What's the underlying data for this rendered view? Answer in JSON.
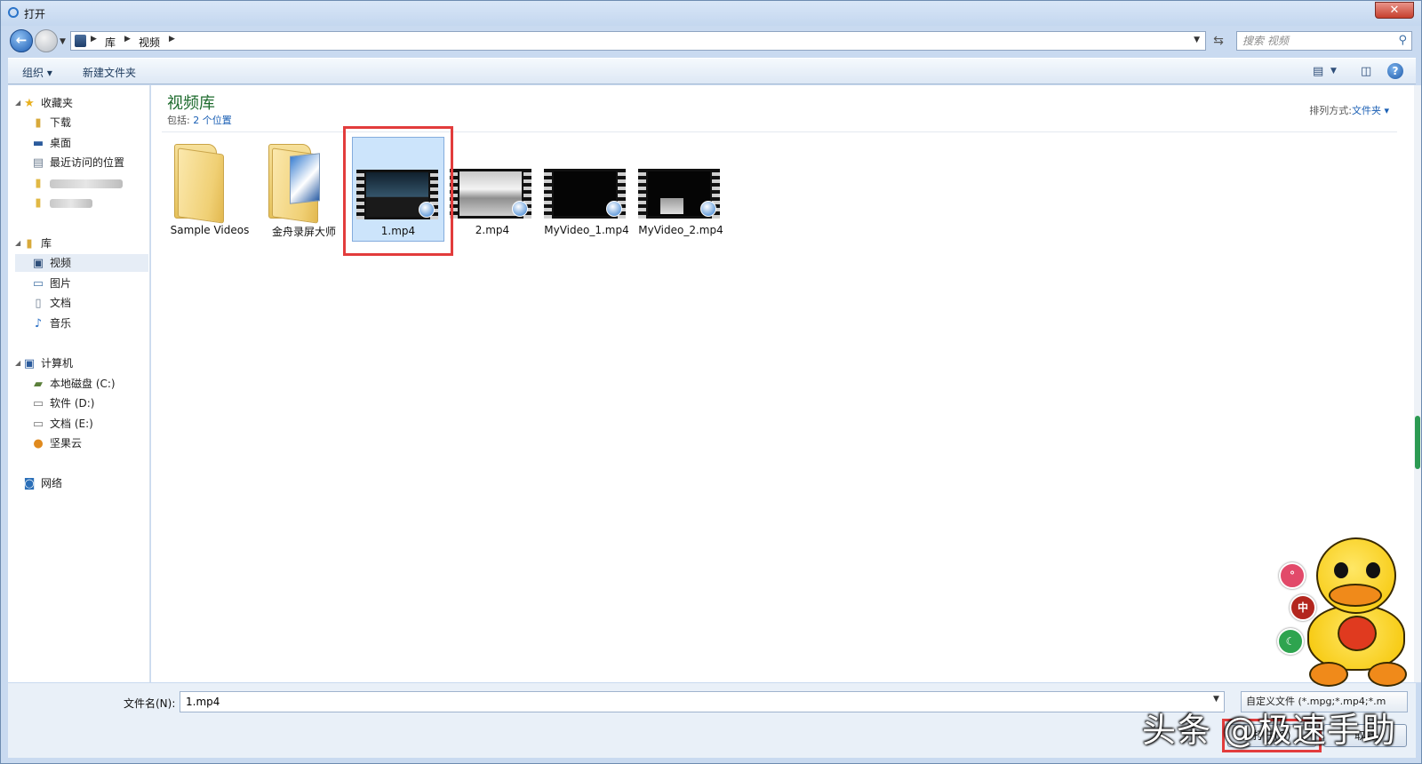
{
  "window": {
    "title": "打开",
    "close_label": "✕"
  },
  "address": {
    "crumbs": [
      "库",
      "视频"
    ]
  },
  "search": {
    "placeholder": "搜索 视频"
  },
  "toolbar": {
    "organize": "组织 ▾",
    "new_folder": "新建文件夹"
  },
  "nav": {
    "favorites": {
      "label": "收藏夹",
      "items": [
        "下载",
        "桌面",
        "最近访问的位置"
      ]
    },
    "libraries": {
      "label": "库",
      "items": [
        "视频",
        "图片",
        "文档",
        "音乐"
      ]
    },
    "computer": {
      "label": "计算机",
      "items": [
        "本地磁盘 (C:)",
        "软件 (D:)",
        "文档 (E:)",
        "坚果云"
      ]
    },
    "network": {
      "label": "网络"
    }
  },
  "content": {
    "title": "视频库",
    "includes_label": "包括:",
    "includes_link": "2 个位置",
    "sort_label": "排列方式:",
    "sort_value": "文件夹 ▾",
    "items": [
      {
        "name": "Sample Videos",
        "kind": "folder"
      },
      {
        "name": "金舟录屏大师",
        "kind": "folder-doc"
      },
      {
        "name": "1.mp4",
        "kind": "video",
        "selected": true
      },
      {
        "name": "2.mp4",
        "kind": "video"
      },
      {
        "name": "MyVideo_1.mp4",
        "kind": "video"
      },
      {
        "name": "MyVideo_2.mp4",
        "kind": "video"
      }
    ]
  },
  "bottom": {
    "filename_label": "文件名(N):",
    "filename_value": "1.mp4",
    "filetype_value": "自定义文件 (*.mpg;*.mp4;*.m",
    "open_label": "打开(O)",
    "cancel_label": "取消"
  },
  "overlay": {
    "watermark": "头条 @极速手助",
    "float_buttons": [
      "°",
      "中",
      "☾"
    ]
  },
  "colors": {
    "accent": "#1a5fb4",
    "title_green": "#1e6b2e",
    "highlight_red": "#e23c3c",
    "selection": "#cce4fb"
  }
}
